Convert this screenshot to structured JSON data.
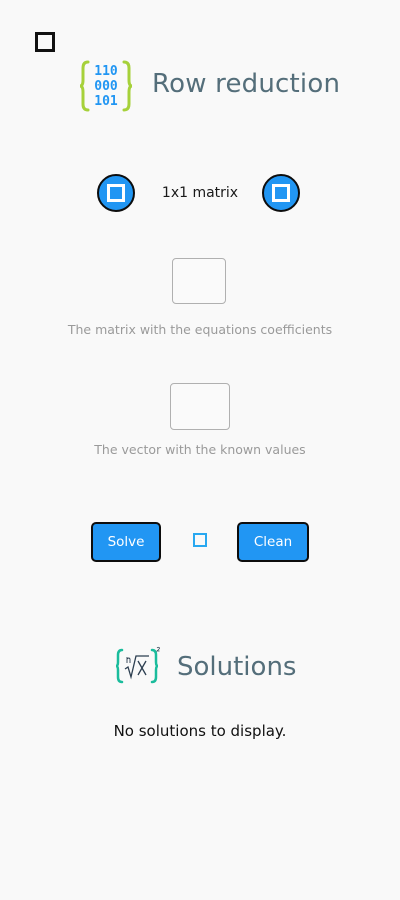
{
  "header": {
    "title": "Row reduction",
    "icon": "binary-matrix-icon",
    "icon_digits": [
      "110",
      "000",
      "101"
    ]
  },
  "menu": {
    "icon": "menu-square-icon"
  },
  "size_stepper": {
    "label": "1x1 matrix",
    "decrease_icon": "square-icon",
    "increase_icon": "square-icon"
  },
  "matrix_input": {
    "value": "",
    "caption": "The matrix with the equations coefficients"
  },
  "vector_input": {
    "value": "",
    "caption": "The vector with the known values"
  },
  "actions": {
    "solve_label": "Solve",
    "clean_label": "Clean",
    "middle_icon": "square-icon"
  },
  "solutions": {
    "title": "Solutions",
    "icon": "root-formula-icon",
    "empty_message": "No solutions to display."
  },
  "colors": {
    "accent": "#2196f3",
    "title": "#546e7a",
    "caption": "#9a9a9a",
    "icon_brace": "#a6d13a",
    "icon_digits": "#2196f3",
    "solutions_icon": "#1abc9c",
    "background": "#f9f9f9"
  }
}
